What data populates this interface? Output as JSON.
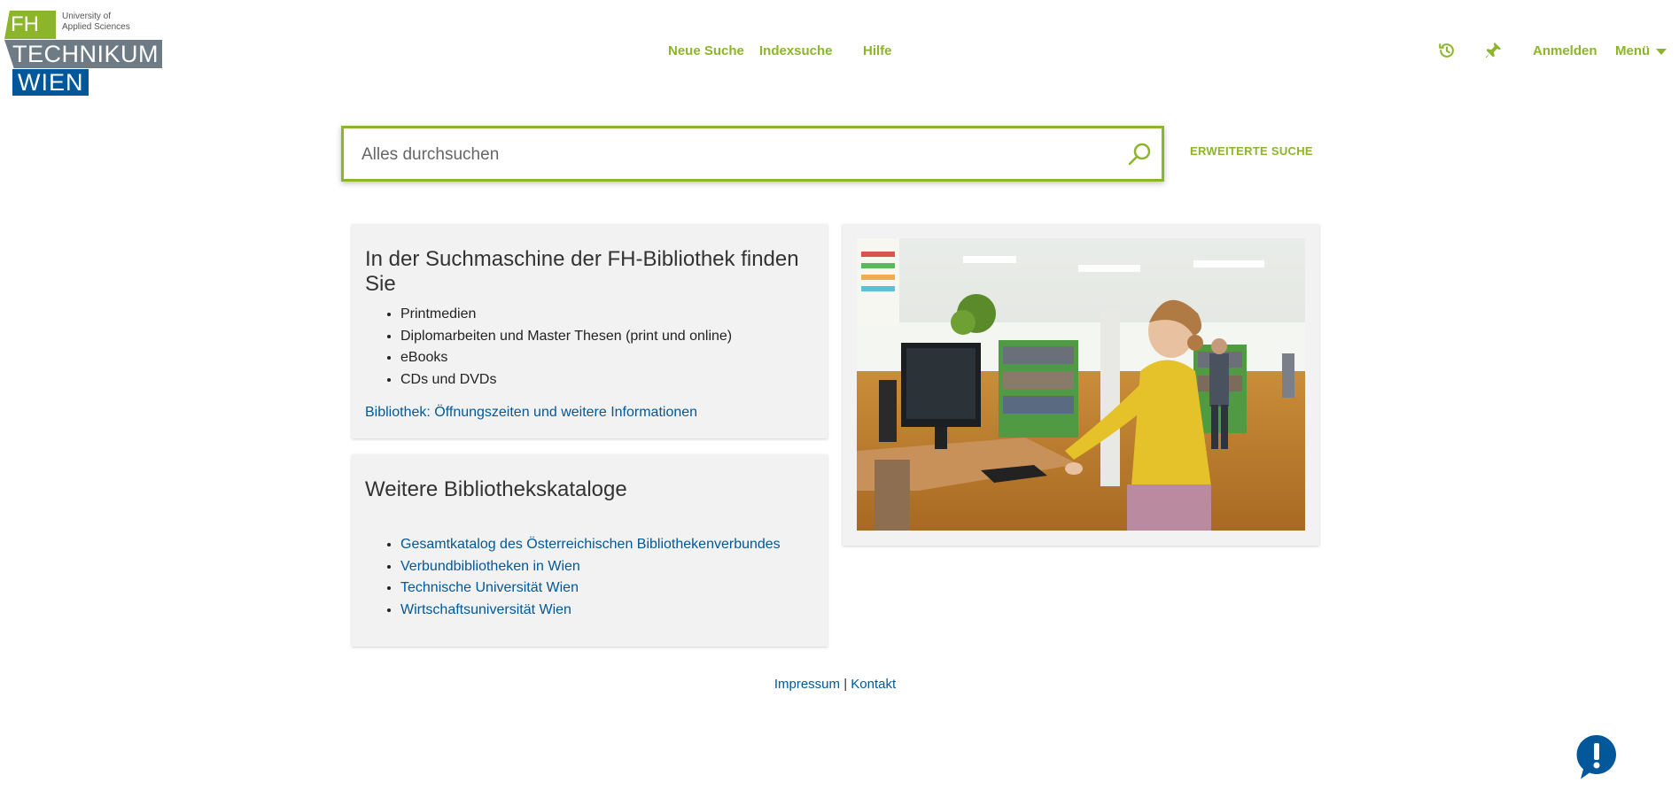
{
  "logo": {
    "fh": "FH",
    "university_line1": "University of",
    "university_line2": "Applied Sciences",
    "technikum": "TECHNIKUM",
    "wien": "WIEN",
    "colors": {
      "green": "#8cb52b",
      "grey": "#6e7b85",
      "blue": "#00589a"
    }
  },
  "nav": {
    "neue_suche": "Neue Suche",
    "indexsuche": "Indexsuche",
    "hilfe": "Hilfe",
    "history_icon": "history-icon",
    "pin_icon": "pin-icon",
    "anmelden": "Anmelden",
    "menu": "Menü"
  },
  "search": {
    "placeholder": "Alles durchsuchen",
    "value": "",
    "button_icon": "search-icon",
    "advanced": "ERWEITERTE SUCHE"
  },
  "card1": {
    "title": "In der Suchmaschine der FH-Bibliothek finden Sie",
    "items": [
      "Printmedien",
      "Diplomarbeiten und Master Thesen (print und online)",
      "eBooks",
      "CDs und DVDs"
    ],
    "link": "Bibliothek: Öffnungszeiten und weitere Informationen"
  },
  "card2": {
    "title": "Weitere Bibliothekskataloge",
    "links": [
      "Gesamtkatalog des Österreichischen Bibliothekenverbundes",
      "Verbundbibliotheken in Wien",
      "Technische Universität Wien",
      "Wirtschaftsuniversität Wien"
    ]
  },
  "footer": {
    "impressum": "Impressum",
    "separator": "|",
    "kontakt": "Kontakt"
  },
  "feedback": {
    "icon": "feedback-exclamation-icon"
  },
  "colors": {
    "accent": "#8cb52b",
    "link": "#00589a",
    "card_bg": "#f2f2f2"
  }
}
